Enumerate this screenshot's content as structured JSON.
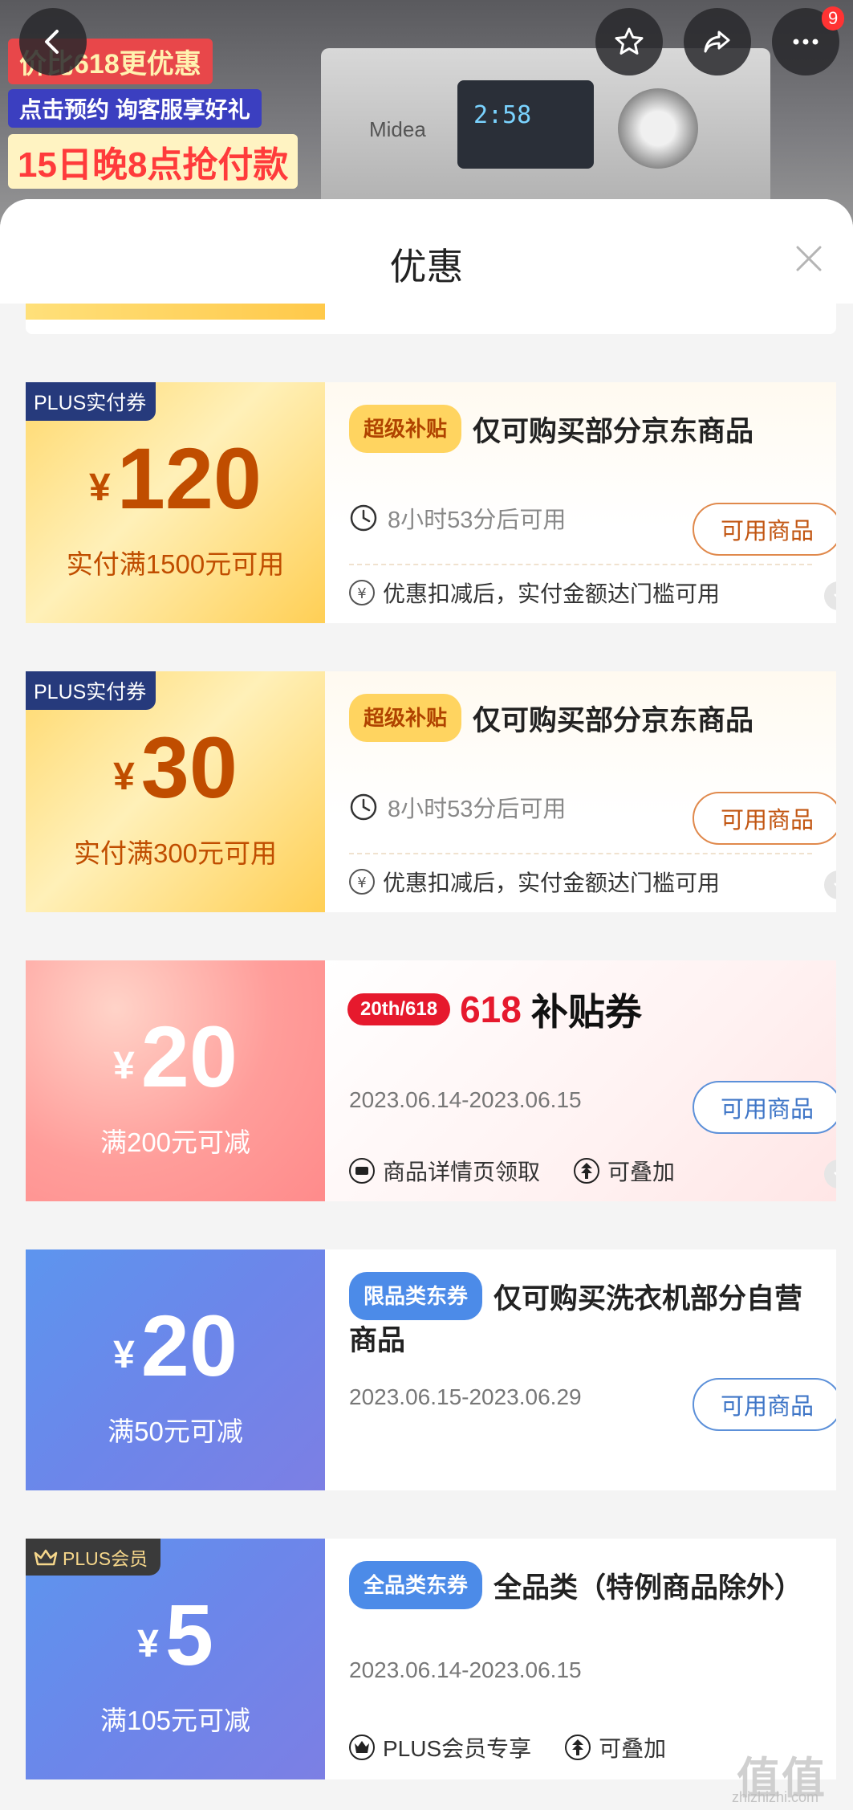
{
  "background": {
    "promo_line1": "价比618更优惠",
    "promo_line2": "点击预约 询客服享好礼",
    "promo_line3": "15日晚8点抢付款",
    "washer_brand": "Midea",
    "washer_display": "2:58",
    "badge_count": "9"
  },
  "sheet": {
    "title": "优惠"
  },
  "coupons": [
    {
      "tag": "PLUS实付券",
      "currency": "¥",
      "amount": "120",
      "condition": "实付满1500元可用",
      "pill": "超级补贴",
      "title": "仅可购买部分京东商品",
      "time": "8小时53分后可用",
      "button": "可用商品",
      "info": "优惠扣减后，实付金额达门槛可用"
    },
    {
      "tag": "PLUS实付券",
      "currency": "¥",
      "amount": "30",
      "condition": "实付满300元可用",
      "pill": "超级补贴",
      "title": "仅可购买部分京东商品",
      "time": "8小时53分后可用",
      "button": "可用商品",
      "info": "优惠扣减后，实付金额达门槛可用"
    },
    {
      "currency": "¥",
      "amount": "20",
      "condition": "满200元可减",
      "logo_pill": "20th/618",
      "logo_red": "618",
      "logo_black": "补贴券",
      "date": "2023.06.14-2023.06.15",
      "button": "可用商品",
      "info1": "商品详情页领取",
      "info2": "可叠加"
    },
    {
      "currency": "¥",
      "amount": "20",
      "condition": "满50元可减",
      "pill": "限品类东券",
      "title": "仅可购买洗衣机部分自营商品",
      "date": "2023.06.15-2023.06.29",
      "button": "可用商品"
    },
    {
      "tag": "PLUS会员",
      "currency": "¥",
      "amount": "5",
      "condition": "满105元可减",
      "pill": "全品类东券",
      "title": "全品类（特例商品除外）",
      "date": "2023.06.14-2023.06.15",
      "info1": "PLUS会员专享",
      "info2": "可叠加"
    }
  ],
  "watermark": {
    "main": "值值值",
    "sub": "zhizhizhi.com"
  },
  "colors": {
    "gold": "#ffd96e",
    "pink": "#ff9d9a",
    "blue": "#6c86ea",
    "accent_red": "#e6192d"
  }
}
